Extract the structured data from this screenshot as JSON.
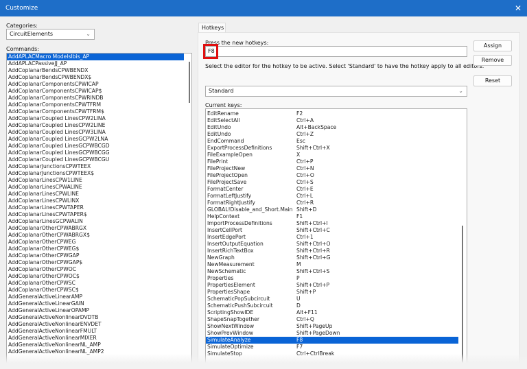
{
  "window": {
    "title": "Customize",
    "close_icon": "close-icon"
  },
  "categories": {
    "label": "Categories:",
    "selected": "CircuitElements"
  },
  "commands": {
    "label": "Commands:",
    "selected_index": 0,
    "items": [
      "AddAPLACMacro ModelsIbis_AP",
      "AddAPLACPassiveJJ_AP",
      "AddCoplanarBendsCPWBENDX",
      "AddCoplanarBendsCPWBENDX$",
      "AddCoplanarComponentsCPWICAP",
      "AddCoplanarComponentsCPWICAP$",
      "AddCoplanarComponentsCPWRINDB",
      "AddCoplanarComponentsCPWTFRM",
      "AddCoplanarComponentsCPWTFRM$",
      "AddCoplanarCoupled LinesCPW2LINA",
      "AddCoplanarCoupled LinesCPW2LINE",
      "AddCoplanarCoupled LinesCPW3LINA",
      "AddCoplanarCoupled LinesGCPW2LNA",
      "AddCoplanarCoupled LinesGCPWBCGD",
      "AddCoplanarCoupled LinesGCPWBCGG",
      "AddCoplanarCoupled LinesGCPWBCGU",
      "AddCoplanarJunctionsCPWTEEX",
      "AddCoplanarJunctionsCPWTEEX$",
      "AddCoplanarLinesCPW1LINE",
      "AddCoplanarLinesCPWALINE",
      "AddCoplanarLinesCPWLINE",
      "AddCoplanarLinesCPWLINX",
      "AddCoplanarLinesCPWTAPER",
      "AddCoplanarLinesCPWTAPER$",
      "AddCoplanarLinesGCPWALIN",
      "AddCoplanarOtherCPWABRGX",
      "AddCoplanarOtherCPWABRGX$",
      "AddCoplanarOtherCPWEG",
      "AddCoplanarOtherCPWEG$",
      "AddCoplanarOtherCPWGAP",
      "AddCoplanarOtherCPWGAP$",
      "AddCoplanarOtherCPWOC",
      "AddCoplanarOtherCPWOC$",
      "AddCoplanarOtherCPWSC",
      "AddCoplanarOtherCPWSC$",
      "AddGeneralActiveLinearAMP",
      "AddGeneralActiveLinearGAIN",
      "AddGeneralActiveLinearOPAMP",
      "AddGeneralActiveNonlinearDVDTB",
      "AddGeneralActiveNonlinearENVDET",
      "AddGeneralActiveNonlinearFMULT",
      "AddGeneralActiveNonlinearMIXER",
      "AddGeneralActiveNonlinearNL_AMP",
      "AddGeneralActiveNonlinearNL_AMP2"
    ]
  },
  "hotkeys": {
    "tab": "Hotkeys",
    "new_label": "Press the new hotkeys:",
    "new_value": "F8",
    "instructions": "Select the editor for the hotkey to be active.  Select 'Standard' to have the hotkey apply to all editors.",
    "editor": "Standard",
    "assign": "Assign",
    "remove": "Remove",
    "reset": "Reset",
    "current_label": "Current keys:",
    "selected_index": 33,
    "keys": [
      [
        "EditRename",
        "F2"
      ],
      [
        "EditSelectAll",
        "Ctrl+A"
      ],
      [
        "EditUndo",
        "Alt+BackSpace"
      ],
      [
        "EditUndo",
        "Ctrl+Z"
      ],
      [
        "EndCommand",
        "Esc"
      ],
      [
        "ExportProcessDefinitions",
        "Shift+Ctrl+X"
      ],
      [
        "FileExampleOpen",
        "X"
      ],
      [
        "FilePrint",
        "Ctrl+P"
      ],
      [
        "FileProjectNew",
        "Ctrl+N"
      ],
      [
        "FileProjectOpen",
        "Ctrl+O"
      ],
      [
        "FileProjectSave",
        "Ctrl+S"
      ],
      [
        "FormatCenter",
        "Ctrl+E"
      ],
      [
        "FormatLeftJustify",
        "Ctrl+L"
      ],
      [
        "FormatRightJustify",
        "Ctrl+R"
      ],
      [
        "GLOBAL!Disable_and_Short.Main",
        "Shift+D"
      ],
      [
        "HelpContext",
        "F1"
      ],
      [
        "ImportProcessDefinitions",
        "Shift+Ctrl+I"
      ],
      [
        "InsertCellPort",
        "Shift+Ctrl+C"
      ],
      [
        "InsertEdgePort",
        "Ctrl+1"
      ],
      [
        "InsertOutputEquation",
        "Shift+Ctrl+O"
      ],
      [
        "InsertRichTextBox",
        "Shift+Ctrl+R"
      ],
      [
        "NewGraph",
        "Shift+Ctrl+G"
      ],
      [
        "NewMeasurement",
        "M"
      ],
      [
        "NewSchematic",
        "Shift+Ctrl+S"
      ],
      [
        "Properties",
        "P"
      ],
      [
        "PropertiesElement",
        "Shift+Ctrl+P"
      ],
      [
        "PropertiesShape",
        "Shift+P"
      ],
      [
        "SchematicPopSubcircuit",
        "U"
      ],
      [
        "SchematicPushSubcircuit",
        "D"
      ],
      [
        "ScriptingShowIDE",
        "Alt+F11"
      ],
      [
        "ShapeSnapTogether",
        "Ctrl+Q"
      ],
      [
        "ShowNextWindow",
        "Shift+PageUp"
      ],
      [
        "ShowPrevWindow",
        "Shift+PageDown"
      ],
      [
        "SimulateAnalyze",
        "F8"
      ],
      [
        "SimulateOptimize",
        "F7"
      ],
      [
        "SimulateStop",
        "Ctrl+CtrlBreak"
      ]
    ]
  }
}
